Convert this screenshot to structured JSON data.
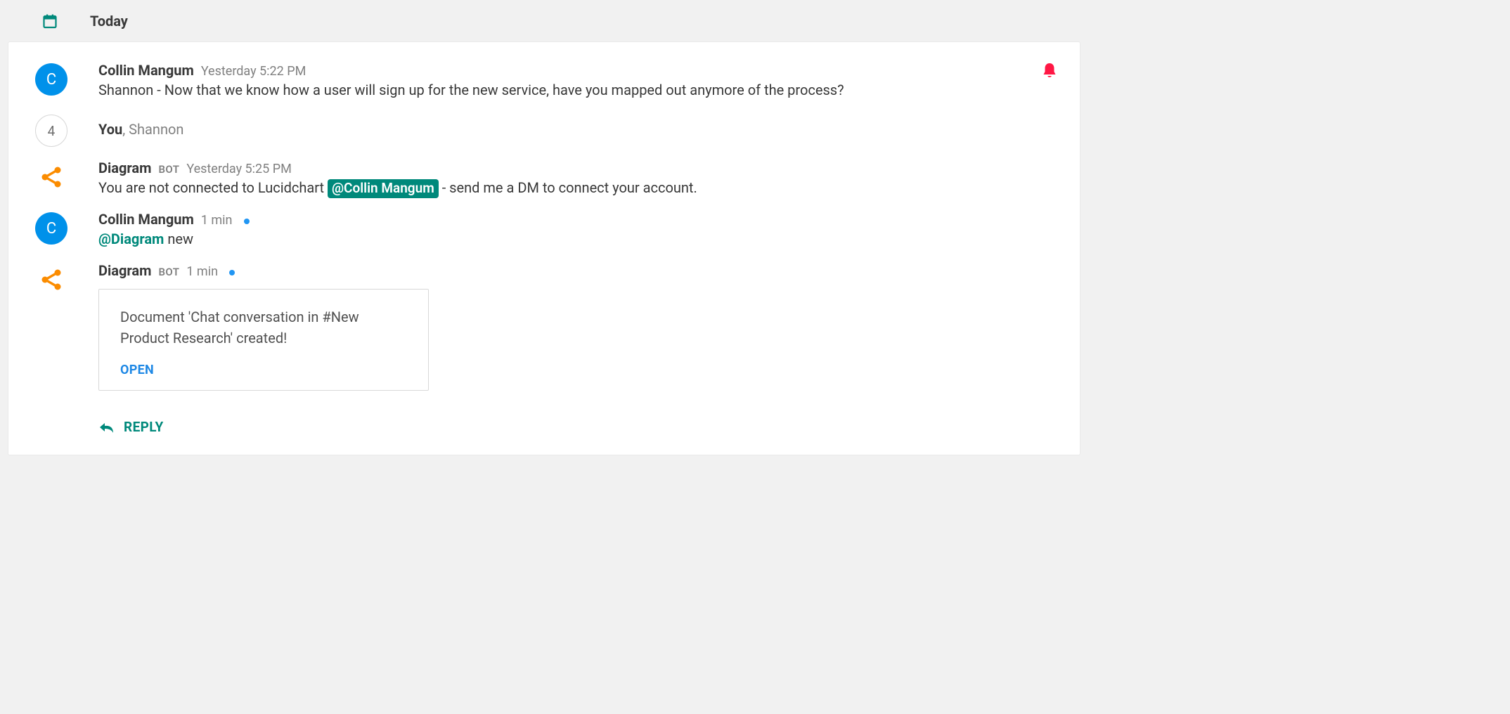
{
  "colors": {
    "accent_teal": "#00897b",
    "avatar_blue": "#0091ea",
    "link_blue": "#1e88e5",
    "alert_red": "#ff1744",
    "share_orange": "#fb8c00"
  },
  "date_separator": {
    "label": "Today"
  },
  "thread": {
    "notification_active": true,
    "messages": [
      {
        "kind": "user",
        "avatar_letter": "C",
        "author": "Collin Mangum",
        "time": "Yesterday 5:22 PM",
        "body": "Shannon - Now that we know how a user will sign up for the new service, have you mapped out anymore of the process?"
      },
      {
        "kind": "readers",
        "count": "4",
        "you_label": "You",
        "rest": ", Shannon"
      },
      {
        "kind": "bot",
        "author": "Diagram",
        "bot_tag": "BOT",
        "time": "Yesterday 5:25 PM",
        "body_pre": "You are not connected to Lucidchart ",
        "mention": "@Collin Mangum",
        "body_post": " - send me a DM to connect your account."
      },
      {
        "kind": "user",
        "avatar_letter": "C",
        "author": "Collin Mangum",
        "time": "1 min",
        "unread": true,
        "command_mention": "@Diagram",
        "command_rest": " new"
      },
      {
        "kind": "bot",
        "author": "Diagram",
        "bot_tag": "BOT",
        "time": "1 min",
        "unread": true,
        "attachment": {
          "text": "Document 'Chat conversation in #New Product Research' created!",
          "action": "OPEN"
        }
      }
    ],
    "reply_label": "REPLY"
  }
}
